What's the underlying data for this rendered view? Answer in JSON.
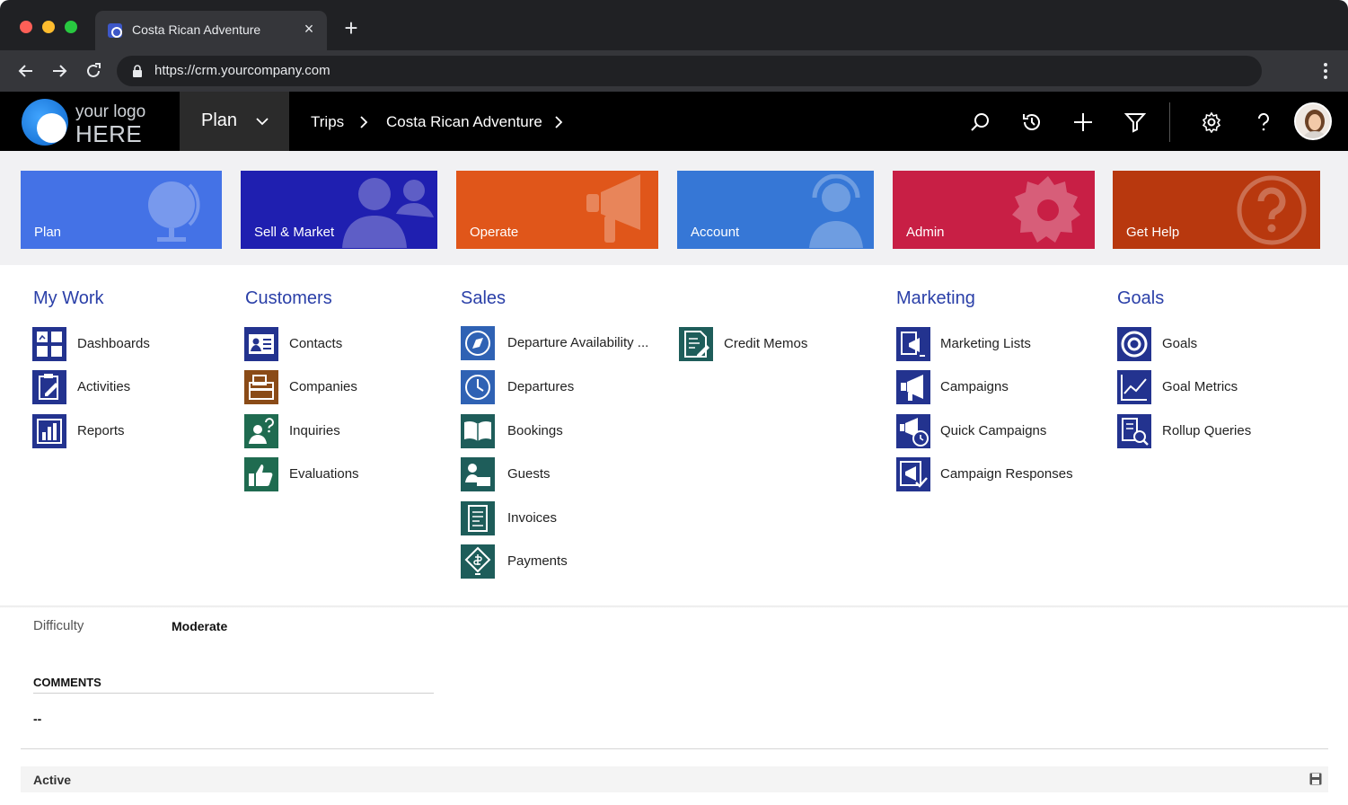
{
  "browser": {
    "tab_title": "Costa Rican Adventure",
    "close_glyph": "×",
    "new_tab_glyph": "+",
    "url": "https://crm.yourcompany.com"
  },
  "app": {
    "logo_line1": "your logo",
    "logo_line2": "HERE",
    "area_menu_label": "Plan",
    "breadcrumbs": [
      "Trips",
      "Costa Rican Adventure"
    ]
  },
  "tiles": [
    {
      "label": "Plan",
      "color": "#4472e6",
      "icon": "globe-icon"
    },
    {
      "label": "Sell & Market",
      "color": "#1f1fb0",
      "icon": "people-icon"
    },
    {
      "label": "Operate",
      "color": "#e0561a",
      "icon": "megaphone-icon"
    },
    {
      "label": "Account",
      "color": "#3677d6",
      "icon": "headset-user-icon"
    },
    {
      "label": "Admin",
      "color": "#c81f45",
      "icon": "gear-icon"
    },
    {
      "label": "Get Help",
      "color": "#b8380e",
      "icon": "question-icon"
    }
  ],
  "menu": {
    "my_work": {
      "heading": "My Work",
      "items": [
        "Dashboards",
        "Activities",
        "Reports"
      ]
    },
    "customers": {
      "heading": "Customers",
      "items": [
        "Contacts",
        "Companies",
        "Inquiries",
        "Evaluations"
      ]
    },
    "sales": {
      "heading": "Sales",
      "items": [
        "Departure Availability ...",
        "Departures",
        "Bookings",
        "Guests",
        "Invoices",
        "Payments"
      ],
      "extra_items": [
        "Credit Memos"
      ]
    },
    "marketing": {
      "heading": "Marketing",
      "items": [
        "Marketing Lists",
        "Campaigns",
        "Quick Campaigns",
        "Campaign Responses"
      ]
    },
    "goals": {
      "heading": "Goals",
      "items": [
        "Goals",
        "Goal Metrics",
        "Rollup Queries"
      ]
    }
  },
  "colors": {
    "accent_blue": "#2a3fa8",
    "icon_navy": "#23338f",
    "icon_brown": "#8a4b17",
    "icon_green": "#1f6b50",
    "icon_teal": "#1e5d5a",
    "icon_blue": "#2f62b4"
  },
  "form": {
    "difficulty_label": "Difficulty",
    "difficulty_value": "Moderate",
    "comments_heading": "COMMENTS",
    "comments_value": "--",
    "status": "Active"
  }
}
